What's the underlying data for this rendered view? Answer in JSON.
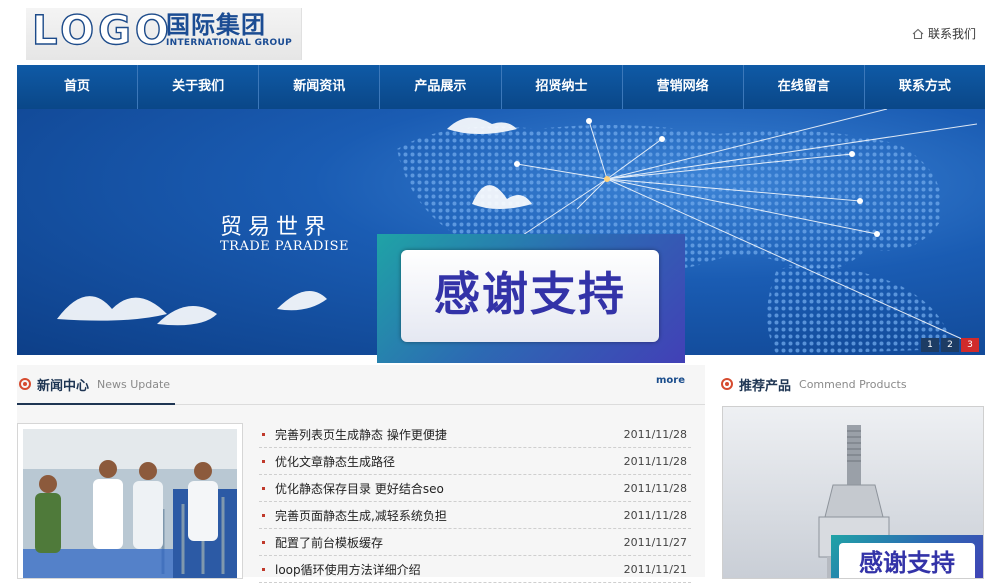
{
  "header": {
    "logo_mark": "LOGO",
    "logo_cn": "国际集团",
    "logo_en": "INTERNATIONAL GROUP",
    "contact_link": "联系我们"
  },
  "nav": {
    "items": [
      "首页",
      "关于我们",
      "新闻资讯",
      "产品展示",
      "招贤纳士",
      "营销网络",
      "在线留言",
      "联系方式"
    ]
  },
  "banner": {
    "title_cn": "贸易世界",
    "title_en": "TRADE PARADISE",
    "pager": [
      "1",
      "2",
      "3"
    ],
    "active_page": "3"
  },
  "overlay": {
    "text": "感谢支持"
  },
  "news": {
    "title": "新闻中心",
    "subtitle": "News Update",
    "more": "more",
    "items": [
      {
        "title": "完善列表页生成静态 操作更便捷",
        "date": "2011/11/28"
      },
      {
        "title": "优化文章静态生成路径",
        "date": "2011/11/28"
      },
      {
        "title": "优化静态保存目录 更好结合seo",
        "date": "2011/11/28"
      },
      {
        "title": "完善页面静态生成,减轻系统负担",
        "date": "2011/11/28"
      },
      {
        "title": "配置了前台模板缓存",
        "date": "2011/11/27"
      },
      {
        "title": "loop循环使用方法详细介绍",
        "date": "2011/11/21"
      }
    ]
  },
  "products": {
    "title": "推荐产品",
    "subtitle": "Commend Products",
    "overlay_text": "感谢支持"
  },
  "colors": {
    "nav_blue": "#0f5aa6",
    "accent_red": "#d64b2f",
    "overlay_text": "#3333a8"
  }
}
